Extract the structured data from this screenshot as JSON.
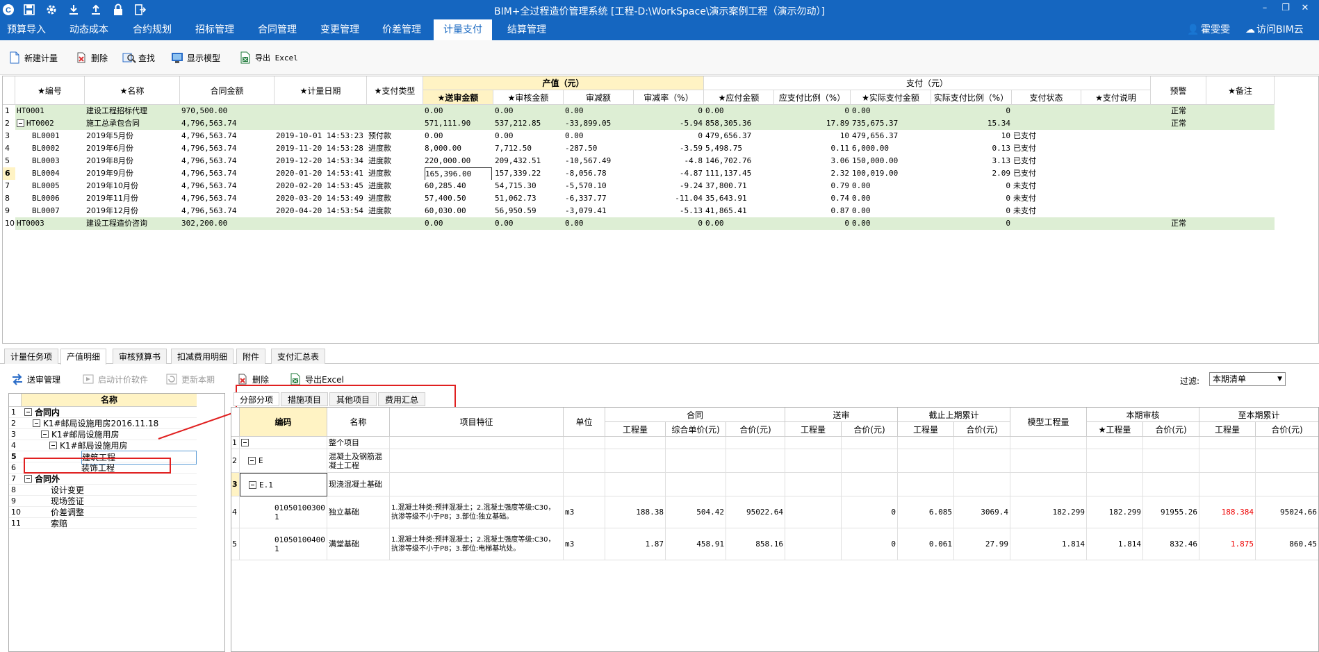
{
  "window": {
    "title": "BIM+全过程造价管理系统 [工程-D:\\WorkSpace\\演示案例工程（演示勿动）]"
  },
  "menu": {
    "items": [
      "预算导入",
      "动态成本",
      "合约规划",
      "招标管理",
      "合同管理",
      "变更管理",
      "价差管理",
      "计量支付",
      "结算管理"
    ],
    "active": "计量支付",
    "user": "霍雯雯",
    "visit": "访问BIM云"
  },
  "toolbar": {
    "new": "新建计量",
    "delete": "删除",
    "find": "查找",
    "model": "显示模型",
    "export": "导出 Excel"
  },
  "top": {
    "headers": {
      "code": "★编号",
      "name": "★名称",
      "amount": "合同金额",
      "date": "★计量日期",
      "paytype": "★支付类型",
      "output_group": "产值（元）",
      "submit": "★送审金额",
      "review": "★审核金额",
      "cut": "审减额",
      "cutrate": "审减率（%）",
      "pay_group": "支付（元）",
      "due": "★应付金额",
      "due_ratio": "应支付比例（%）",
      "actual": "★实际支付金额",
      "actual_ratio": "实际支付比例（%）",
      "status": "支付状态",
      "desc": "★支付说明",
      "warn": "预警",
      "note": "★备注"
    },
    "rows": [
      {
        "n": "1",
        "code": "HT0001",
        "name": "建设工程招标代理",
        "amount": "970,500.00",
        "date": "",
        "type": "",
        "submit": "0.00",
        "review": "0.00",
        "cut": "0.00",
        "rate": "0",
        "due": "0.00",
        "dueR": "0",
        "act": "0.00",
        "actR": "0",
        "status": "",
        "warn": "正常"
      },
      {
        "n": "2",
        "code": "HT0002",
        "name": "施工总承包合同",
        "amount": "4,796,563.74",
        "date": "",
        "type": "",
        "submit": "571,111.90",
        "review": "537,212.85",
        "cut": "-33,899.05",
        "rate": "-5.94",
        "due": "858,305.36",
        "dueR": "17.89",
        "act": "735,675.37",
        "actR": "15.34",
        "status": "",
        "warn": "正常"
      },
      {
        "n": "3",
        "code": "BL0001",
        "name": "2019年5月份",
        "amount": "4,796,563.74",
        "date": "2019-10-01 14:53:23",
        "type": "预付款",
        "submit": "0.00",
        "review": "0.00",
        "cut": "0.00",
        "rate": "0",
        "due": "479,656.37",
        "dueR": "10",
        "act": "479,656.37",
        "actR": "10",
        "status": "已支付",
        "warn": ""
      },
      {
        "n": "4",
        "code": "BL0002",
        "name": "2019年6月份",
        "amount": "4,796,563.74",
        "date": "2019-11-20 14:53:28",
        "type": "进度款",
        "submit": "8,000.00",
        "review": "7,712.50",
        "cut": "-287.50",
        "rate": "-3.59",
        "due": "5,498.75",
        "dueR": "0.11",
        "act": "6,000.00",
        "actR": "0.13",
        "status": "已支付",
        "warn": ""
      },
      {
        "n": "5",
        "code": "BL0003",
        "name": "2019年8月份",
        "amount": "4,796,563.74",
        "date": "2019-12-20 14:53:34",
        "type": "进度款",
        "submit": "220,000.00",
        "review": "209,432.51",
        "cut": "-10,567.49",
        "rate": "-4.8",
        "due": "146,702.76",
        "dueR": "3.06",
        "act": "150,000.00",
        "actR": "3.13",
        "status": "已支付",
        "warn": ""
      },
      {
        "n": "6",
        "code": "BL0004",
        "name": "2019年9月份",
        "amount": "4,796,563.74",
        "date": "2020-01-20 14:53:41",
        "type": "进度款",
        "submit": "165,396.00",
        "review": "157,339.22",
        "cut": "-8,056.78",
        "rate": "-4.87",
        "due": "111,137.45",
        "dueR": "2.32",
        "act": "100,019.00",
        "actR": "2.09",
        "status": "已支付",
        "warn": ""
      },
      {
        "n": "7",
        "code": "BL0005",
        "name": "2019年10月份",
        "amount": "4,796,563.74",
        "date": "2020-02-20 14:53:45",
        "type": "进度款",
        "submit": "60,285.40",
        "review": "54,715.30",
        "cut": "-5,570.10",
        "rate": "-9.24",
        "due": "37,800.71",
        "dueR": "0.79",
        "act": "0.00",
        "actR": "0",
        "status": "未支付",
        "warn": ""
      },
      {
        "n": "8",
        "code": "BL0006",
        "name": "2019年11月份",
        "amount": "4,796,563.74",
        "date": "2020-03-20 14:53:49",
        "type": "进度款",
        "submit": "57,400.50",
        "review": "51,062.73",
        "cut": "-6,337.77",
        "rate": "-11.04",
        "due": "35,643.91",
        "dueR": "0.74",
        "act": "0.00",
        "actR": "0",
        "status": "未支付",
        "warn": ""
      },
      {
        "n": "9",
        "code": "BL0007",
        "name": "2019年12月份",
        "amount": "4,796,563.74",
        "date": "2020-04-20 14:53:54",
        "type": "进度款",
        "submit": "60,030.00",
        "review": "56,950.59",
        "cut": "-3,079.41",
        "rate": "-5.13",
        "due": "41,865.41",
        "dueR": "0.87",
        "act": "0.00",
        "actR": "0",
        "status": "未支付",
        "warn": ""
      },
      {
        "n": "10",
        "code": "HT0003",
        "name": "建设工程造价咨询",
        "amount": "302,200.00",
        "date": "",
        "type": "",
        "submit": "0.00",
        "review": "0.00",
        "cut": "0.00",
        "rate": "0",
        "due": "0.00",
        "dueR": "0",
        "act": "0.00",
        "actR": "0",
        "status": "",
        "warn": "正常"
      }
    ]
  },
  "bottom_tabs": [
    "计量任务项",
    "产值明细",
    "审核预算书",
    "扣减费用明细",
    "附件",
    "支付汇总表"
  ],
  "bottom_active": "产值明细",
  "bottom_toolbar": {
    "submit_mgmt": "送审管理",
    "launch": "启动计价软件",
    "update": "更新本期",
    "delete": "删除",
    "export": "导出Excel",
    "filter_label": "过滤:",
    "filter_value": "本期清单"
  },
  "tree": {
    "header": "名称",
    "rows": [
      {
        "n": "1",
        "label": "合同内"
      },
      {
        "n": "2",
        "label": "K1#邮局设施用房2016.11.18"
      },
      {
        "n": "3",
        "label": "K1#邮局设施用房"
      },
      {
        "n": "4",
        "label": "K1#邮局设施用房"
      },
      {
        "n": "5",
        "label": "建筑工程"
      },
      {
        "n": "6",
        "label": "装饰工程"
      },
      {
        "n": "7",
        "label": "合同外"
      },
      {
        "n": "8",
        "label": "设计变更"
      },
      {
        "n": "9",
        "label": "现场签证"
      },
      {
        "n": "10",
        "label": "价差调整"
      },
      {
        "n": "11",
        "label": "索赔"
      }
    ]
  },
  "detail_tabs": [
    "分部分项",
    "措施项目",
    "其他项目",
    "费用汇总"
  ],
  "detail_active": "分部分项",
  "detail": {
    "headers": {
      "code": "编码",
      "name": "名称",
      "feature": "项目特征",
      "unit": "单位",
      "contract": "合同",
      "qty": "工程量",
      "uprice": "综合单价(元)",
      "total": "合价(元)",
      "submit": "送审",
      "prev": "截止上期累计",
      "model": "模型工程量",
      "cur": "本期审核",
      "curqty": "★工程量",
      "todate": "至本期累计"
    },
    "rows": [
      {
        "n": "1",
        "code": "",
        "name": "整个项目",
        "feature": "",
        "unit": "",
        "cq": "",
        "cu": "",
        "ct": "",
        "st": "",
        "pq": "",
        "pt": "",
        "mq": "",
        "rq": "",
        "rt": "",
        "tq": "",
        "tt": ""
      },
      {
        "n": "2",
        "code": "E",
        "name": "混凝土及钢筋混凝土工程",
        "feature": "",
        "unit": "",
        "cq": "",
        "cu": "",
        "ct": "",
        "st": "",
        "pq": "",
        "pt": "",
        "mq": "",
        "rq": "",
        "rt": "",
        "tq": "",
        "tt": ""
      },
      {
        "n": "3",
        "code": "E.1",
        "name": "现浇混凝土基础",
        "feature": "",
        "unit": "",
        "cq": "",
        "cu": "",
        "ct": "",
        "st": "",
        "pq": "",
        "pt": "",
        "mq": "",
        "rq": "",
        "rt": "",
        "tq": "",
        "tt": ""
      },
      {
        "n": "4",
        "code": "010501003001",
        "name": "独立基础",
        "feature": "1.混凝土种类:预拌混凝土；2.混凝土强度等级:C30，抗渗等级不小于P8；3.部位:独立基础。",
        "unit": "m3",
        "cq": "188.38",
        "cu": "504.42",
        "ct": "95022.64",
        "st": "0",
        "pq": "6.085",
        "pt": "3069.4",
        "mq": "182.299",
        "rq": "182.299",
        "rt": "91955.26",
        "tq": "188.384",
        "tt": "95024.66"
      },
      {
        "n": "5",
        "code": "010501004001",
        "name": "满堂基础",
        "feature": "1.混凝土种类:预拌混凝土；2.混凝土强度等级:C30，抗渗等级不小于P8；3.部位:电梯基坑处。",
        "unit": "m3",
        "cq": "1.87",
        "cu": "458.91",
        "ct": "858.16",
        "st": "0",
        "pq": "0.061",
        "pt": "27.99",
        "mq": "1.814",
        "rq": "1.814",
        "rt": "832.46",
        "tq": "1.875",
        "tt": "860.45"
      }
    ]
  },
  "colors": {
    "brand": "#1566c0",
    "output_header": "#fff3c4",
    "group_row": "#ddeed4",
    "highlight": "#e02020"
  }
}
